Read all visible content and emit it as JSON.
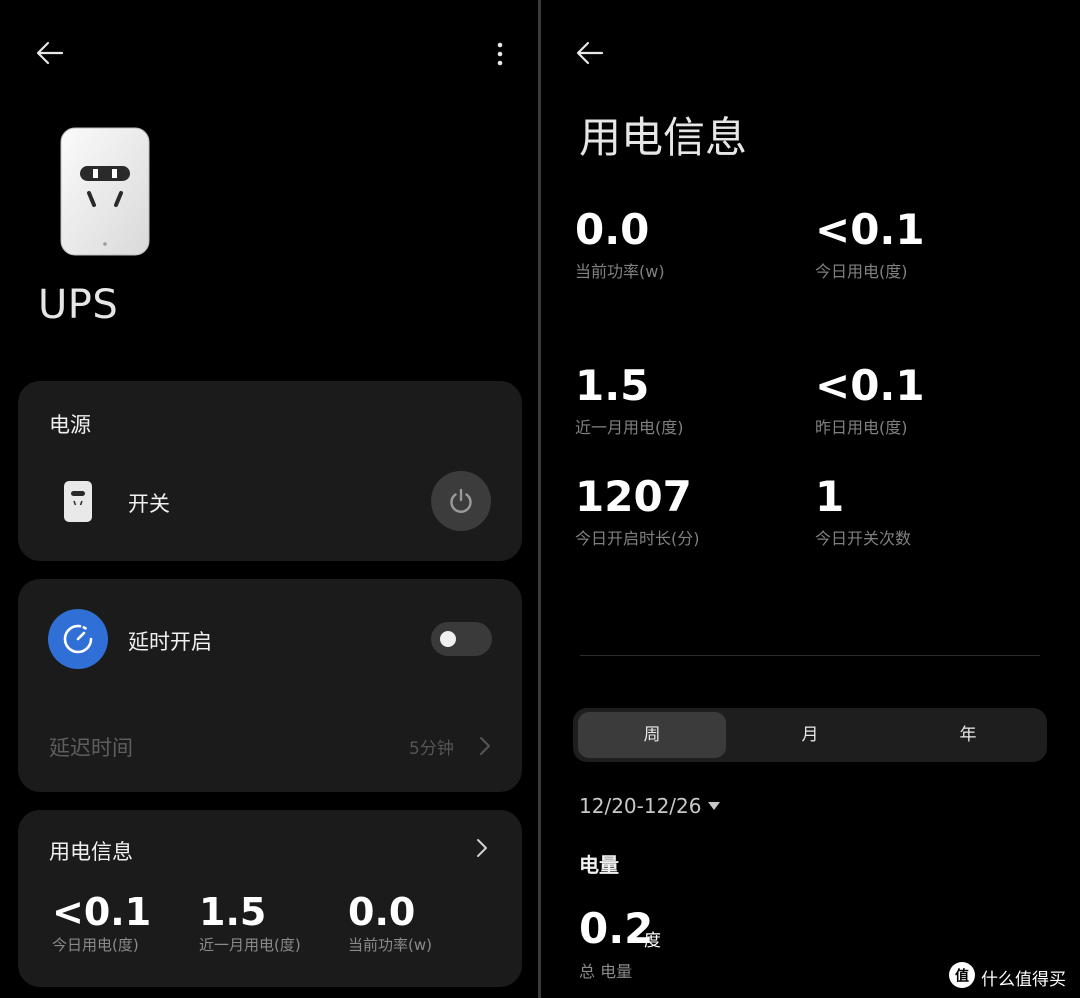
{
  "left": {
    "device_name": "UPS",
    "power_card": {
      "title": "电源",
      "switch_label": "开关"
    },
    "delay_card": {
      "title": "延时开启",
      "toggle_on": false,
      "delay_label": "延迟时间",
      "delay_value": "5分钟"
    },
    "usage_card": {
      "title": "用电信息",
      "stats": [
        {
          "value": "<0.1",
          "label": "今日用电(度)"
        },
        {
          "value": "1.5",
          "label": "近一月用电(度)"
        },
        {
          "value": "0.0",
          "label": "当前功率(w)"
        }
      ]
    }
  },
  "right": {
    "title": "用电信息",
    "stats": [
      {
        "value": "0.0",
        "label": "当前功率(w)"
      },
      {
        "value": "<0.1",
        "label": "今日用电(度)"
      },
      {
        "value": "1.5",
        "label": "近一月用电(度)"
      },
      {
        "value": "<0.1",
        "label": "昨日用电(度)"
      },
      {
        "value": "1207",
        "label": "今日开启时长(分)"
      },
      {
        "value": "1",
        "label": "今日开关次数"
      }
    ],
    "tabs": [
      {
        "label": "周",
        "active": true
      },
      {
        "label": "月",
        "active": false
      },
      {
        "label": "年",
        "active": false
      }
    ],
    "date_range": "12/20-12/26",
    "section_title": "电量",
    "total_value": "0.2",
    "total_unit": "度",
    "total_label": "总 电量"
  },
  "watermark": {
    "icon_text": "值",
    "text": "什么值得买"
  },
  "colors": {
    "background": "#000000",
    "card": "#1b1b1b",
    "accent_blue": "#2f6fd6"
  }
}
